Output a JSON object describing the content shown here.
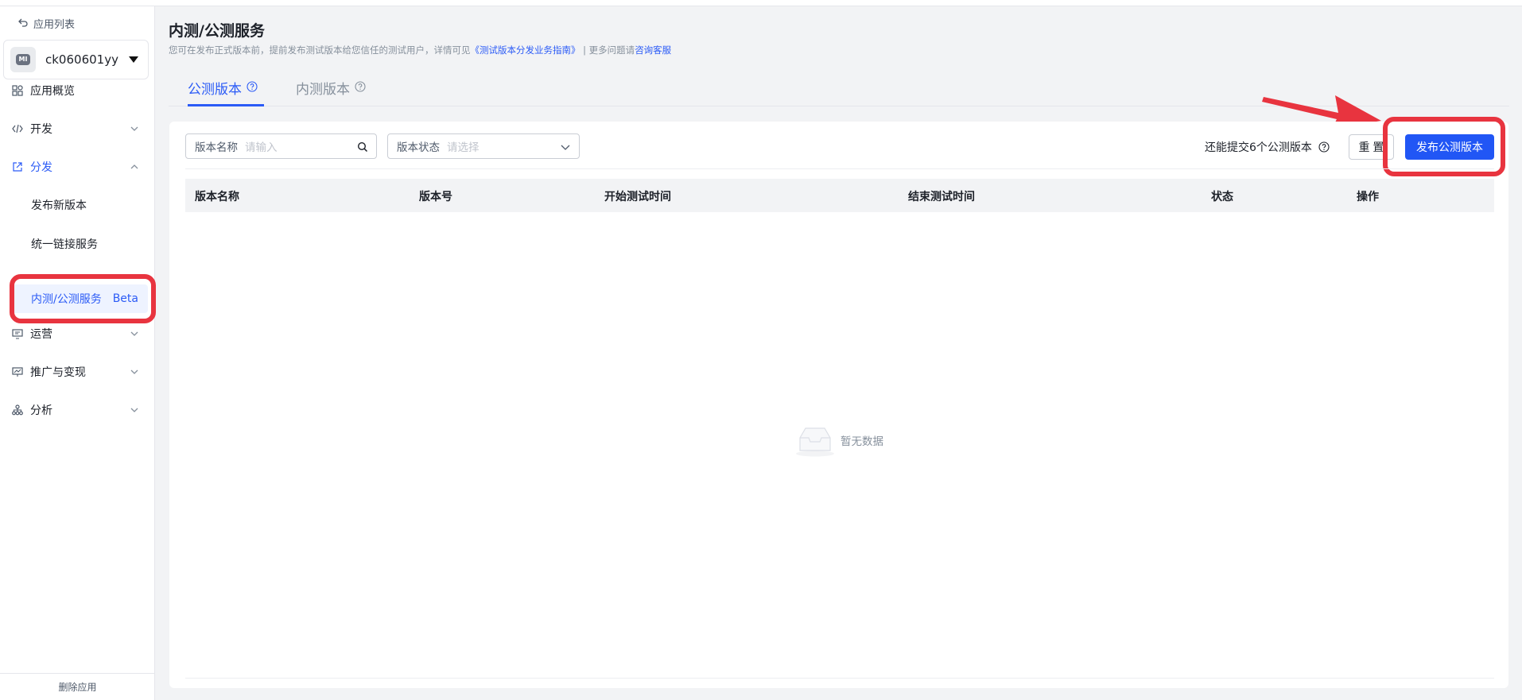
{
  "sidebar": {
    "back_label": "应用列表",
    "app_logo_text": "MI",
    "app_name": "ck060601yy",
    "items": [
      {
        "label": "应用概览"
      },
      {
        "label": "开发"
      },
      {
        "label": "分发"
      },
      {
        "label": "运营"
      },
      {
        "label": "推广与变现"
      },
      {
        "label": "分析"
      }
    ],
    "sub_items": [
      {
        "label": "发布新版本"
      },
      {
        "label": "统一链接服务"
      },
      {
        "label": "内测/公测服务",
        "badge": "Beta"
      }
    ],
    "footer_label": "删除应用"
  },
  "header": {
    "title": "内测/公测服务",
    "desc_prefix": "您可在发布正式版本前，提前发布测试版本给您信任的测试用户，详情可见",
    "desc_link": "《测试版本分发业务指南》",
    "desc_mid": " | 更多问题请",
    "desc_link2": "咨询客服"
  },
  "tabs": [
    {
      "label": "公测版本"
    },
    {
      "label": "内测版本"
    }
  ],
  "filters": {
    "name_label": "版本名称",
    "name_placeholder": "请输入",
    "status_label": "版本状态",
    "status_placeholder": "请选择"
  },
  "toolbar": {
    "quota_text": "还能提交6个公测版本",
    "reset_label": "重 置",
    "publish_label": "发布公测版本"
  },
  "table": {
    "columns": [
      "版本名称",
      "版本号",
      "开始测试时间",
      "结束测试时间",
      "状态",
      "操作"
    ],
    "empty_text": "暂无数据"
  },
  "colors": {
    "accent": "#2b5bf6",
    "highlight": "#e8343f"
  }
}
